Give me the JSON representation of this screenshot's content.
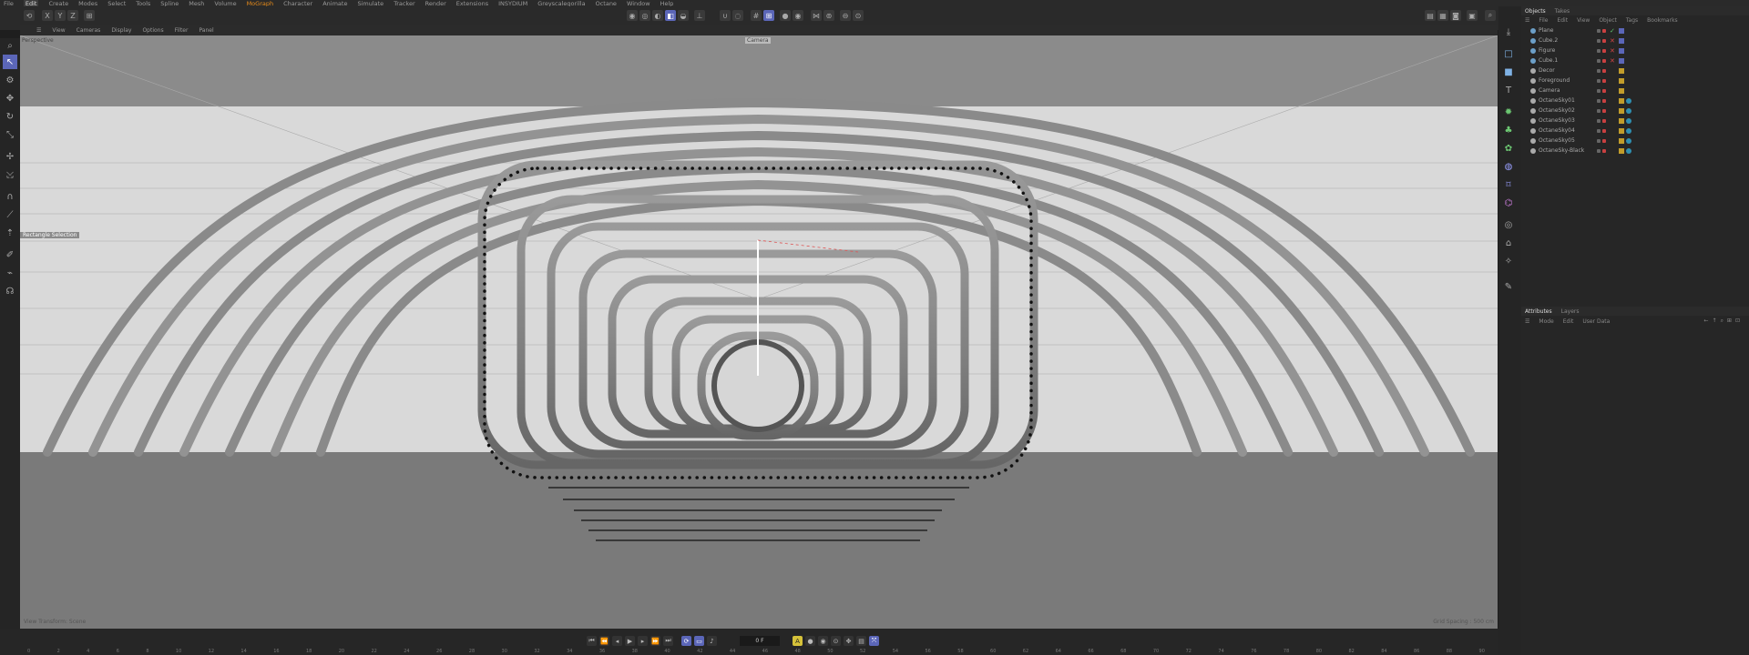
{
  "menu": [
    "File",
    "Edit",
    "Create",
    "Modes",
    "Select",
    "Tools",
    "Spline",
    "Mesh",
    "Volume",
    "MoGraph",
    "Character",
    "Animate",
    "Simulate",
    "Tracker",
    "Render",
    "Extensions",
    "INSYDIUM",
    "Greyscalegorilla",
    "Octane",
    "Window",
    "Help"
  ],
  "menu_active": "Edit",
  "menu_orange": "MoGraph",
  "axis_lock": [
    "X",
    "Y",
    "Z"
  ],
  "viewport": {
    "menu": [
      "View",
      "Cameras",
      "Display",
      "Options",
      "Filter",
      "Panel"
    ],
    "label": "Perspective",
    "camera_label": "Camera",
    "overlay_label": "Rectangle Selection",
    "status_left": "View Transform: Scene",
    "status_right": "Grid Spacing : 500 cm"
  },
  "timeline": {
    "frame": "0 F",
    "ticks": [
      "0",
      "2",
      "4",
      "6",
      "8",
      "10",
      "12",
      "14",
      "16",
      "18",
      "20",
      "22",
      "24",
      "26",
      "28",
      "30",
      "32",
      "34",
      "36",
      "38",
      "40",
      "42",
      "44",
      "46",
      "48",
      "50",
      "52",
      "54",
      "56",
      "58",
      "60",
      "62",
      "64",
      "66",
      "68",
      "70",
      "72",
      "74",
      "76",
      "78",
      "80",
      "82",
      "84",
      "86",
      "88",
      "90"
    ]
  },
  "objects_panel": {
    "tabs": [
      "Objects",
      "Takes"
    ],
    "menu": [
      "File",
      "Edit",
      "View",
      "Object",
      "Tags",
      "Bookmarks"
    ],
    "rows": [
      {
        "name": "Plane",
        "icon": "plane-icon",
        "color": "#6c9fc8",
        "flag": "check"
      },
      {
        "name": "Cube.2",
        "icon": "cube-icon",
        "color": "#6c9fc8",
        "flag": "x"
      },
      {
        "name": "Figure",
        "icon": "figure-icon",
        "color": "#6c9fc8",
        "flag": "x"
      },
      {
        "name": "Cube.1",
        "icon": "cube-icon",
        "color": "#6c9fc8",
        "flag": "x"
      },
      {
        "name": "Decor",
        "icon": "null-icon",
        "color": "#aaaaaa",
        "flag": ""
      },
      {
        "name": "Foreground",
        "icon": "null-icon",
        "color": "#aaaaaa",
        "flag": ""
      },
      {
        "name": "Camera",
        "icon": "camera-icon",
        "color": "#aaaaaa",
        "flag": ""
      },
      {
        "name": "OctaneSky01",
        "icon": "sky-icon",
        "color": "#aaaaaa",
        "flag": ""
      },
      {
        "name": "OctaneSky02",
        "icon": "sky-icon",
        "color": "#aaaaaa",
        "flag": ""
      },
      {
        "name": "OctaneSky03",
        "icon": "sky-icon",
        "color": "#aaaaaa",
        "flag": ""
      },
      {
        "name": "OctaneSky04",
        "icon": "sky-icon",
        "color": "#aaaaaa",
        "flag": ""
      },
      {
        "name": "OctaneSky05",
        "icon": "sky-icon",
        "color": "#aaaaaa",
        "flag": ""
      },
      {
        "name": "OctaneSky-Black",
        "icon": "sky-icon",
        "color": "#aaaaaa",
        "flag": ""
      }
    ]
  },
  "attributes_panel": {
    "tabs": [
      "Attributes",
      "Layers"
    ],
    "menu": [
      "Mode",
      "Edit",
      "User Data"
    ]
  }
}
